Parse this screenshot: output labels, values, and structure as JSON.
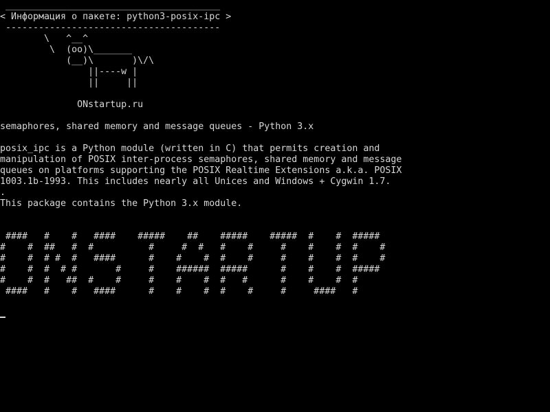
{
  "terminal": {
    "lines": [
      " _______________________________________",
      "< Информация о пакете: python3-posix-ipc >",
      " ---------------------------------------",
      "        \\   ^__^",
      "         \\  (oo)\\_______",
      "            (__)\\       )\\/\\",
      "                ||----w |",
      "                ||     ||",
      "",
      "              ONstartup.ru",
      "",
      "semaphores, shared memory and message queues - Python 3.x",
      "",
      "posix_ipc is a Python module (written in C) that permits creation and",
      "manipulation of POSIX inter-process semaphores, shared memory and message",
      "queues on platforms supporting the POSIX Realtime Extensions a.k.a. POSIX",
      "1003.1b-1993. This includes nearly all Unices and Windows + Cygwin 1.7.",
      ".",
      "This package contains the Python 3.x module.",
      "",
      "",
      " ####   #    #   ####    #####    ##    #####    #####  #    #  #####",
      "#    #  ##   #  #          #     #  #   #    #     #    #    #  #    #",
      "#    #  # #  #   ####      #    #    #  #    #     #    #    #  #    #",
      "#    #  #  # #       #     #    ######  #####      #    #    #  #####",
      "#    #  #   ##  #    #     #    #    #  #   #      #    #    #  #",
      " ####   #    #   ####      #    #    #  #    #     #     ####   #"
    ]
  }
}
